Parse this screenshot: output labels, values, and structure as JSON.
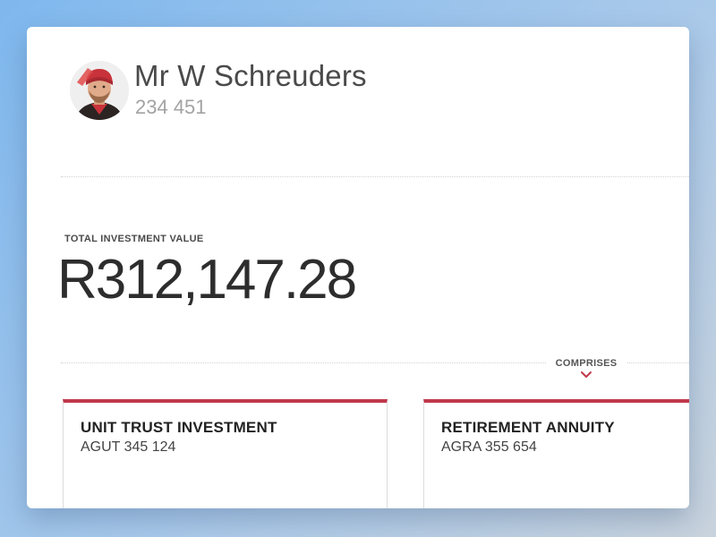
{
  "user": {
    "name": "Mr W Schreuders",
    "number": "234 451"
  },
  "investment": {
    "total_label": "TOTAL INVESTMENT VALUE",
    "total_value": "R312,147.28"
  },
  "comprises": {
    "label": "COMPRISES",
    "icon": "chevron-down-icon"
  },
  "accounts": [
    {
      "title": "UNIT TRUST INVESTMENT",
      "number": "AGUT 345 124"
    },
    {
      "title": "RETIREMENT ANNUITY",
      "number": "AGRA 355 654"
    }
  ],
  "colors": {
    "accent": "#c0394b",
    "background_start": "#7fb8ee",
    "background_end": "#c9d3dd"
  }
}
